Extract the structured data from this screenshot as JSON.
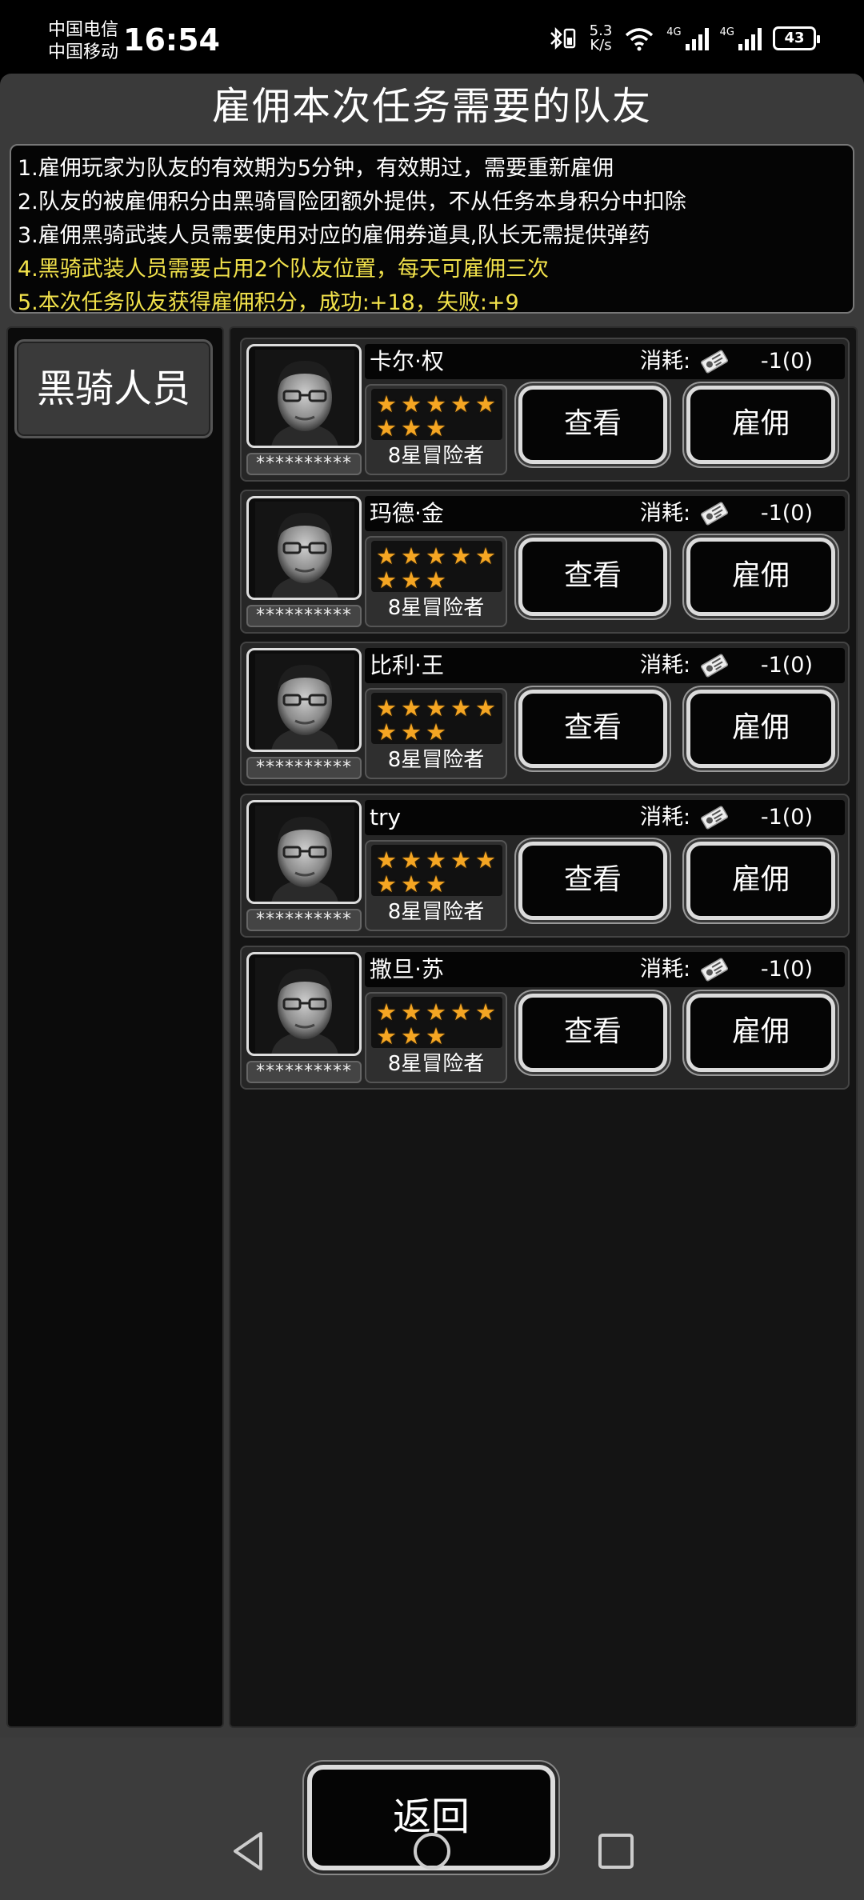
{
  "status": {
    "carrier1": "中国电信",
    "carrier2": "中国移动",
    "time": "16:54",
    "speed_value": "5.3",
    "speed_unit": "K/s",
    "sig1": "4G",
    "sig2": "4G",
    "battery": "43"
  },
  "title": "雇佣本次任务需要的队友",
  "rules": [
    "1.雇佣玩家为队友的有效期为5分钟，有效期过，需要重新雇佣",
    "2.队友的被雇佣积分由黑骑冒险团额外提供，不从任务本身积分中扣除",
    "3.雇佣黑骑武装人员需要使用对应的雇佣券道具,队长无需提供弹药",
    "4.黑骑武装人员需要占用2个队友位置，每天可雇佣三次",
    "5.本次任务队友获得雇佣积分，成功:+18，失败:+9"
  ],
  "category": "黑骑人员",
  "cost_label": "消耗:",
  "view_label": "查看",
  "hire_label": "雇佣",
  "members": [
    {
      "name": "卡尔·权",
      "hidden": "**********",
      "cost": "-1(0)",
      "stars": 8,
      "rank": "8星冒险者"
    },
    {
      "name": "玛德·金",
      "hidden": "**********",
      "cost": "-1(0)",
      "stars": 8,
      "rank": "8星冒险者"
    },
    {
      "name": "比利·王",
      "hidden": "**********",
      "cost": "-1(0)",
      "stars": 8,
      "rank": "8星冒险者"
    },
    {
      "name": "try",
      "hidden": "**********",
      "cost": "-1(0)",
      "stars": 8,
      "rank": "8星冒险者"
    },
    {
      "name": "撒旦·苏",
      "hidden": "**********",
      "cost": "-1(0)",
      "stars": 8,
      "rank": "8星冒险者"
    }
  ],
  "back_label": "返回"
}
